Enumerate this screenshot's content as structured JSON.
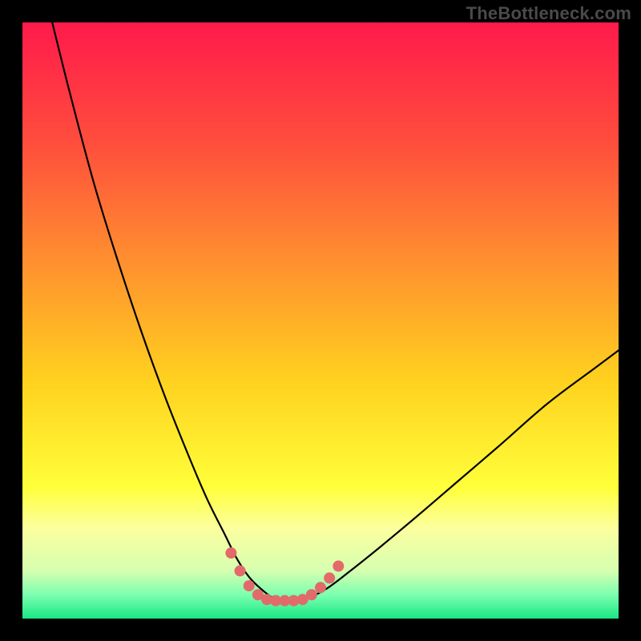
{
  "watermark": "TheBottleneck.com",
  "chart_data": {
    "type": "line",
    "title": "",
    "xlabel": "",
    "ylabel": "",
    "xlim": [
      0,
      100
    ],
    "ylim": [
      0,
      100
    ],
    "grid": false,
    "legend": false,
    "background_gradient_stops": [
      {
        "offset": 0.0,
        "color": "#ff1a4b"
      },
      {
        "offset": 0.2,
        "color": "#ff4d3d"
      },
      {
        "offset": 0.4,
        "color": "#ff8f2f"
      },
      {
        "offset": 0.6,
        "color": "#ffd11f"
      },
      {
        "offset": 0.78,
        "color": "#ffff3a"
      },
      {
        "offset": 0.85,
        "color": "#fbffa0"
      },
      {
        "offset": 0.92,
        "color": "#d6ffb0"
      },
      {
        "offset": 0.96,
        "color": "#7dffb0"
      },
      {
        "offset": 1.0,
        "color": "#18e884"
      }
    ],
    "series": [
      {
        "name": "bottleneck-curve",
        "color": "#000000",
        "stroke_width": 2.2,
        "x": [
          5,
          8,
          12,
          16,
          20,
          24,
          28,
          31,
          34,
          36,
          38,
          40,
          42,
          44,
          46,
          48,
          51,
          55,
          60,
          66,
          73,
          80,
          88,
          96,
          100
        ],
        "y": [
          100,
          88,
          73,
          60,
          48,
          37,
          27,
          20,
          14,
          10,
          7,
          5,
          3.5,
          3,
          3,
          3.5,
          5,
          8,
          12,
          17,
          23,
          29,
          36,
          42,
          45
        ]
      }
    ],
    "markers": {
      "name": "valley-dots",
      "color": "#e26a6a",
      "radius": 7,
      "points": [
        {
          "x": 35.0,
          "y": 11.0
        },
        {
          "x": 36.5,
          "y": 8.0
        },
        {
          "x": 38.0,
          "y": 5.5
        },
        {
          "x": 39.5,
          "y": 4.0
        },
        {
          "x": 41.0,
          "y": 3.2
        },
        {
          "x": 42.5,
          "y": 3.0
        },
        {
          "x": 44.0,
          "y": 3.0
        },
        {
          "x": 45.5,
          "y": 3.0
        },
        {
          "x": 47.0,
          "y": 3.2
        },
        {
          "x": 48.5,
          "y": 4.0
        },
        {
          "x": 50.0,
          "y": 5.2
        },
        {
          "x": 51.5,
          "y": 6.8
        },
        {
          "x": 53.0,
          "y": 8.8
        }
      ]
    }
  }
}
